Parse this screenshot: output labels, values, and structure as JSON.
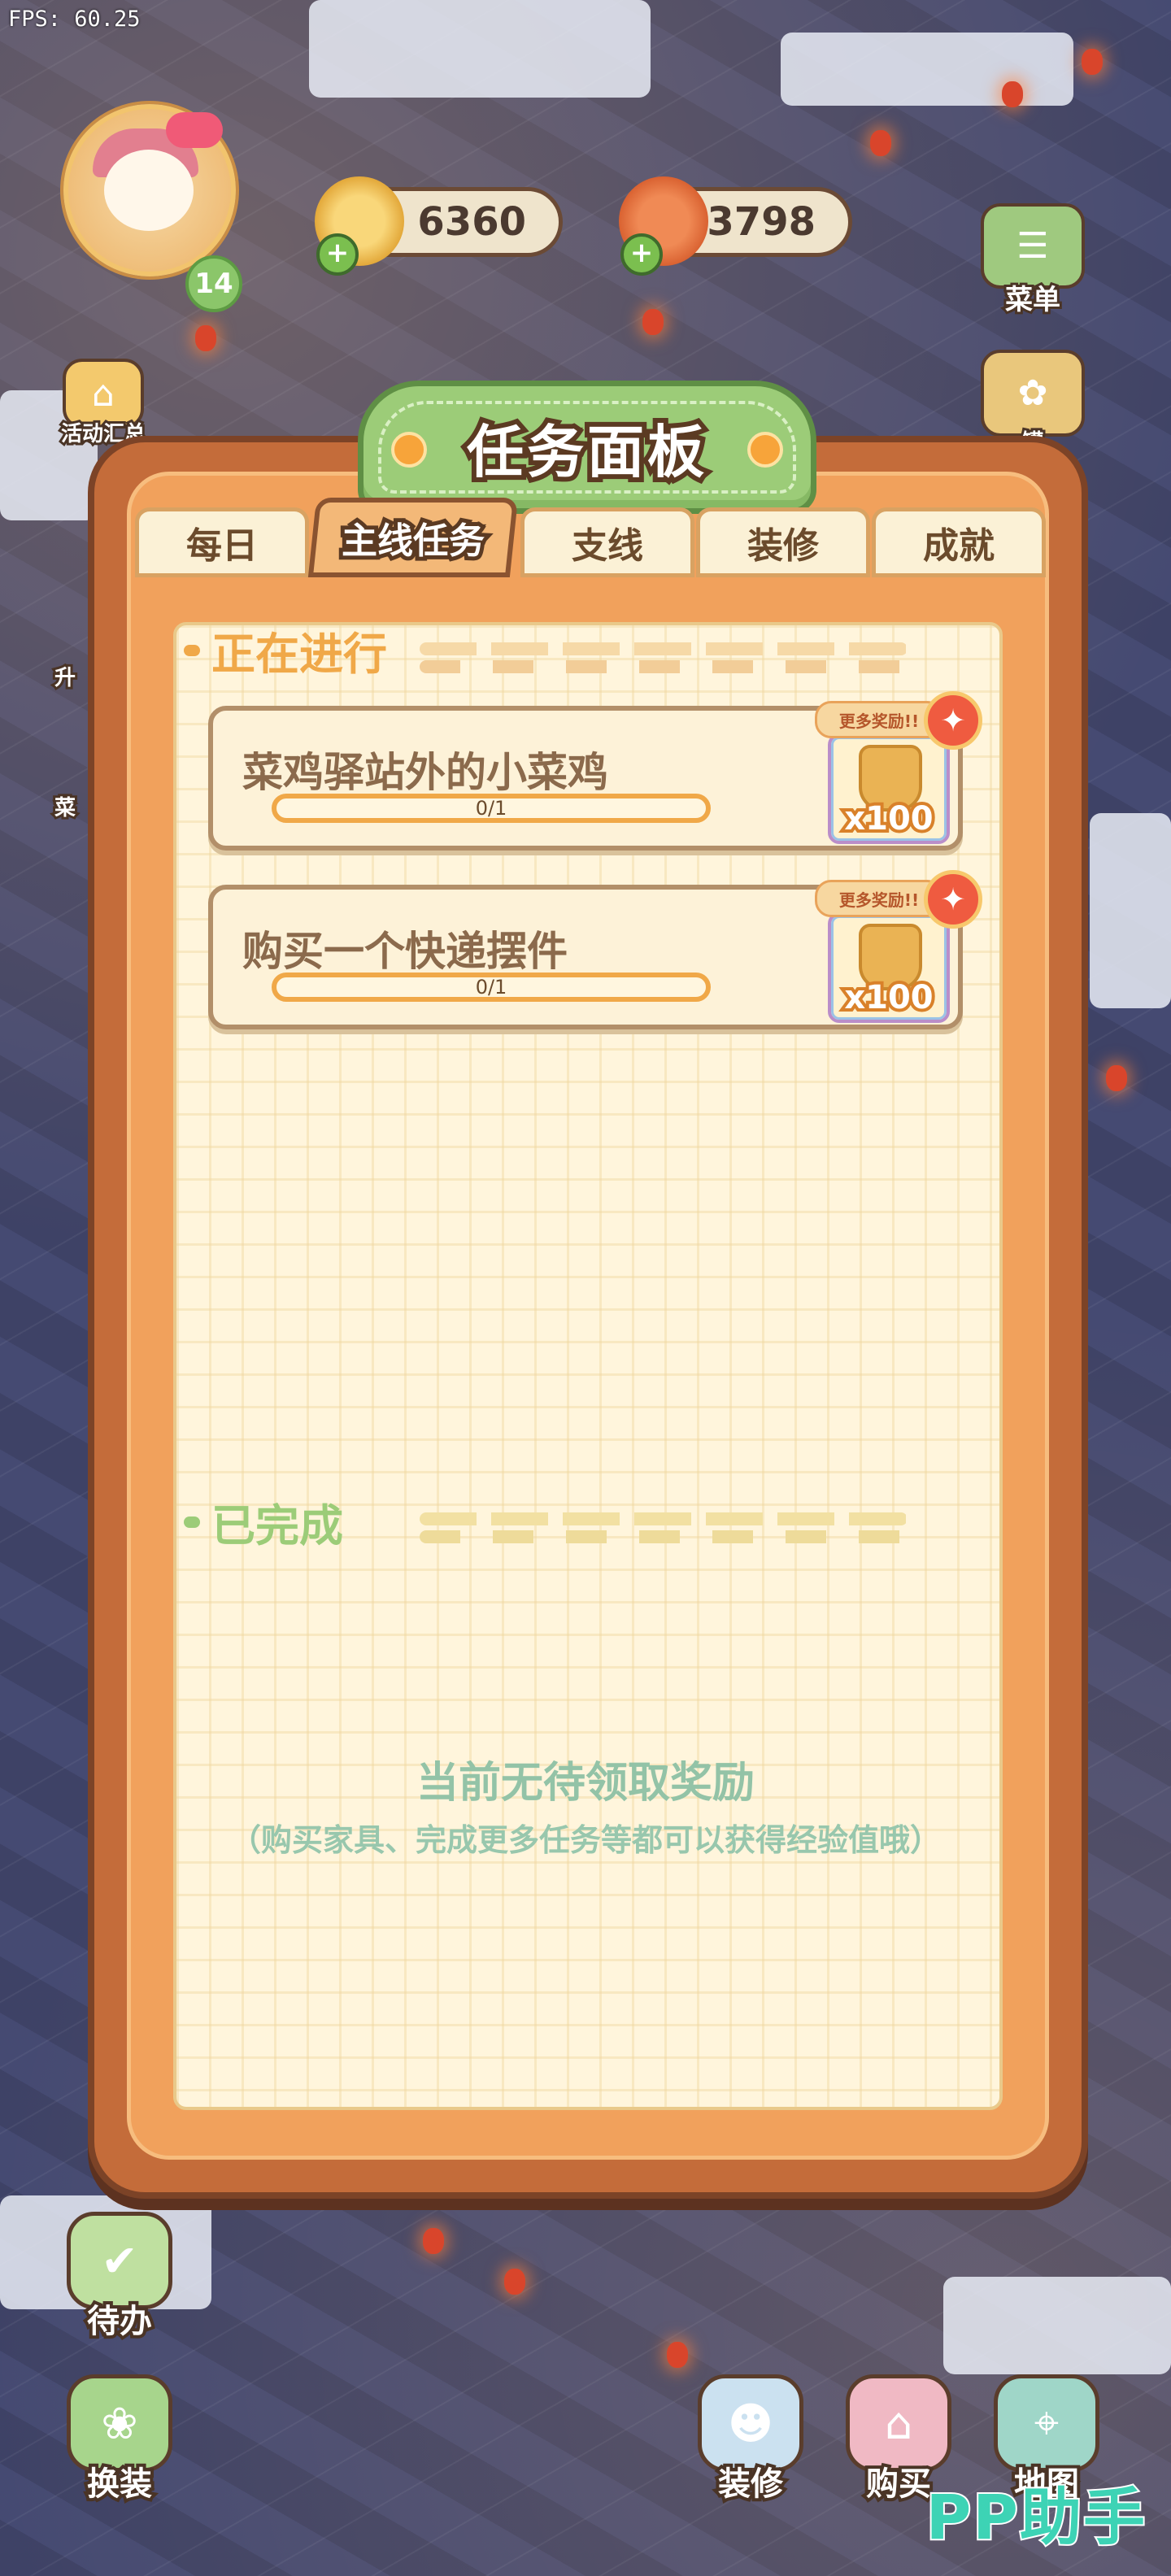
{
  "hud": {
    "fps": "FPS: 60.25",
    "level": "14",
    "coins": "6360",
    "food": "3798"
  },
  "side_left": [
    {
      "label": "活动汇总"
    },
    {
      "label": "升"
    },
    {
      "label": "菜"
    }
  ],
  "side_right": [
    {
      "label": "菜单"
    },
    {
      "label": "罐"
    }
  ],
  "panel": {
    "title": "任务面板",
    "tabs": [
      {
        "label": "每日"
      },
      {
        "label": "主线任务"
      },
      {
        "label": "支线"
      },
      {
        "label": "装修"
      },
      {
        "label": "成就"
      }
    ],
    "active_tab": "主线任务",
    "in_progress_title": "正在进行",
    "tasks": [
      {
        "name": "菜鸡驿站外的小菜鸡",
        "progress_text": "0/1",
        "progress": 0,
        "more_label": "更多奖励!!",
        "reward_qty": "x100"
      },
      {
        "name": "购买一个快递摆件",
        "progress_text": "0/1",
        "progress": 0,
        "more_label": "更多奖励!!",
        "reward_qty": "x100"
      }
    ],
    "completed_title": "已完成",
    "empty_title": "当前无待领取奖励",
    "empty_hint": "（购买家具、完成更多任务等都可以获得经验值哦）"
  },
  "bottom": [
    {
      "label": "待办"
    },
    {
      "label": "换装"
    },
    {
      "label": "装修"
    },
    {
      "label": "购买"
    },
    {
      "label": "地图"
    }
  ],
  "watermark": "PP助手",
  "colors": {
    "panel_orange": "#f1a15c",
    "title_green": "#9ccc78",
    "in_progress_orange": "#f0a848",
    "completed_green": "#93c3a7"
  }
}
